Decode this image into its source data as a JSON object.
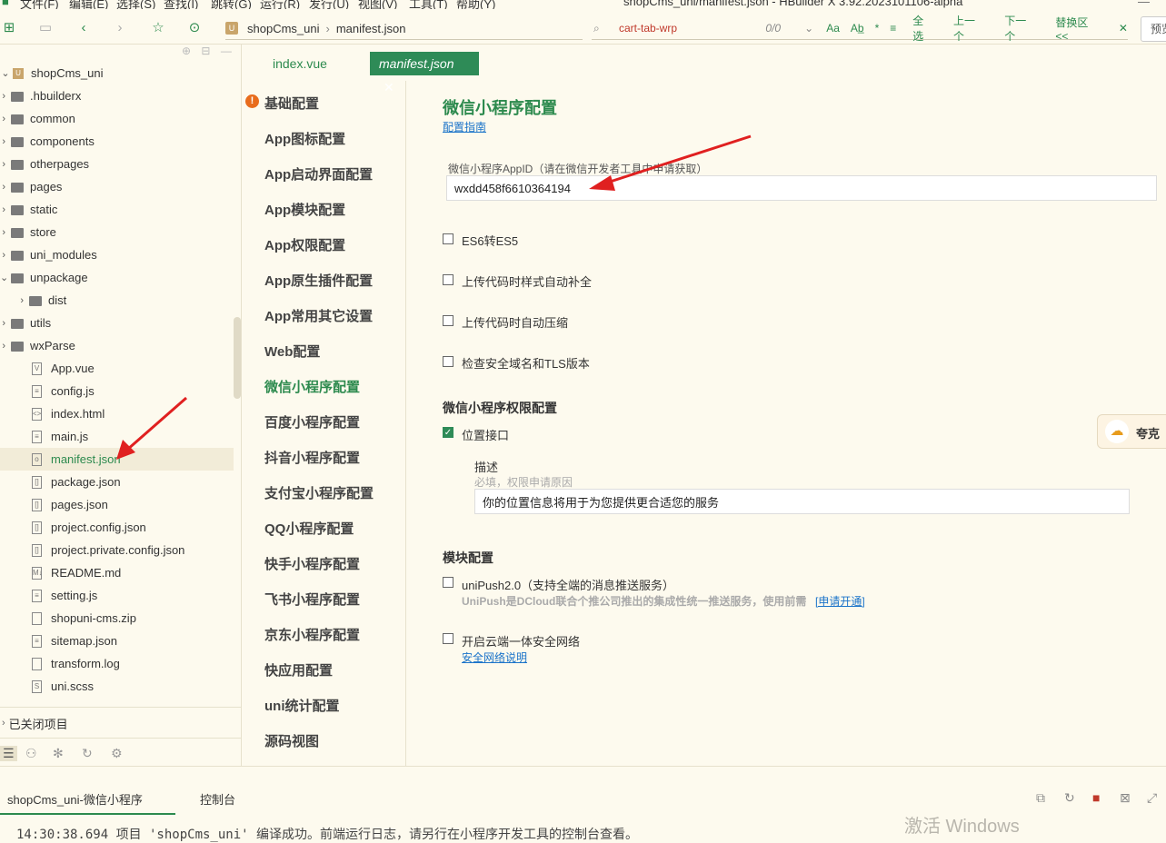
{
  "menubar": {
    "items": [
      "文件(F)",
      "编辑(E)",
      "选择(S)",
      "查找(I)",
      "跳转(G)",
      "运行(R)",
      "发行(U)",
      "视图(V)",
      "工具(T)",
      "帮助(Y)"
    ],
    "window_title": "shopCms_uni/manifest.json - HBuilder X 3.92.2023101106-alpha"
  },
  "toolbar": {
    "breadcrumb": [
      "shopCms_uni",
      "manifest.json"
    ],
    "find_query": "cart-tab-wrp",
    "find_count": "0/0",
    "find_aa": "Aa",
    "find_ab": "Ab̲",
    "find_actions": [
      "全选",
      "上一个",
      "下一个",
      "替换区<<"
    ],
    "find_close": "✕",
    "preview": "预览"
  },
  "sidebar": {
    "project": "shopCms_uni",
    "items": [
      {
        "label": ".hbuilderx",
        "type": "folder"
      },
      {
        "label": "common",
        "type": "folder"
      },
      {
        "label": "components",
        "type": "folder"
      },
      {
        "label": "otherpages",
        "type": "folder"
      },
      {
        "label": "pages",
        "type": "folder"
      },
      {
        "label": "static",
        "type": "folder"
      },
      {
        "label": "store",
        "type": "folder"
      },
      {
        "label": "uni_modules",
        "type": "folder"
      },
      {
        "label": "unpackage",
        "type": "folder-open"
      },
      {
        "label": "dist",
        "type": "folder-child"
      },
      {
        "label": "utils",
        "type": "folder"
      },
      {
        "label": "wxParse",
        "type": "folder"
      },
      {
        "label": "App.vue",
        "type": "file",
        "glyph": "V"
      },
      {
        "label": "config.js",
        "type": "file",
        "glyph": "≡"
      },
      {
        "label": "index.html",
        "type": "file",
        "glyph": "<>"
      },
      {
        "label": "main.js",
        "type": "file",
        "glyph": "≡"
      },
      {
        "label": "manifest.json",
        "type": "file",
        "glyph": "o",
        "selected": true
      },
      {
        "label": "package.json",
        "type": "file",
        "glyph": "[]"
      },
      {
        "label": "pages.json",
        "type": "file",
        "glyph": "[]"
      },
      {
        "label": "project.config.json",
        "type": "file",
        "glyph": "[]"
      },
      {
        "label": "project.private.config.json",
        "type": "file",
        "glyph": "[]"
      },
      {
        "label": "README.md",
        "type": "file",
        "glyph": "M↓"
      },
      {
        "label": "setting.js",
        "type": "file",
        "glyph": "≡"
      },
      {
        "label": "shopuni-cms.zip",
        "type": "file",
        "glyph": ""
      },
      {
        "label": "sitemap.json",
        "type": "file",
        "glyph": "≡"
      },
      {
        "label": "transform.log",
        "type": "file",
        "glyph": ""
      },
      {
        "label": "uni.scss",
        "type": "file",
        "glyph": "S"
      }
    ],
    "closed_projects": "已关闭项目"
  },
  "tabs": [
    {
      "label": "index.vue",
      "active": false
    },
    {
      "label": "manifest.json",
      "active": true
    }
  ],
  "settings_nav": [
    "基础配置",
    "App图标配置",
    "App启动界面配置",
    "App模块配置",
    "App权限配置",
    "App原生插件配置",
    "App常用其它设置",
    "Web配置",
    "微信小程序配置",
    "百度小程序配置",
    "抖音小程序配置",
    "支付宝小程序配置",
    "QQ小程序配置",
    "快手小程序配置",
    "飞书小程序配置",
    "京东小程序配置",
    "快应用配置",
    "uni统计配置",
    "源码视图"
  ],
  "settings_nav_active": "微信小程序配置",
  "content": {
    "title": "微信小程序配置",
    "guide_link": "配置指南",
    "appid_label": "微信小程序AppID（请在微信开发者工具中申请获取）",
    "appid_value": "wxdd458f6610364194",
    "options": [
      {
        "label": "ES6转ES5",
        "checked": false
      },
      {
        "label": "上传代码时样式自动补全",
        "checked": false
      },
      {
        "label": "上传代码时自动压缩",
        "checked": false
      },
      {
        "label": "检查安全域名和TLS版本",
        "checked": false
      }
    ],
    "perm_title": "微信小程序权限配置",
    "perm_location_label": "位置接口",
    "perm_location_checked": true,
    "desc_label": "描述",
    "desc_hint": "必填，权限申请原因",
    "desc_value": "你的位置信息将用于为您提供更合适您的服务",
    "module_title": "模块配置",
    "unipush_label": "uniPush2.0（支持全端的消息推送服务）",
    "unipush_desc": "UniPush是DCloud联合个推公司推出的集成性统一推送服务，使用前需",
    "unipush_link": "[申请开通]",
    "secure_label": "开启云端一体安全网络",
    "secure_link": "安全网络说明"
  },
  "widget": {
    "label": "夸克"
  },
  "bottom": {
    "tab1": "shopCms_uni-微信小程序",
    "tab2": "控制台",
    "log": "14:30:38.694 项目 'shopCms_uni' 编译成功。前端运行日志，请另行在小程序开发工具的控制台查看。",
    "watermark": "激活 Windows"
  },
  "colors": {
    "accent": "#2d8a4e",
    "active_tab_bg": "#2e8b57",
    "arrow": "#e02020",
    "link": "#1a73c9",
    "bg": "#fdfaee"
  }
}
